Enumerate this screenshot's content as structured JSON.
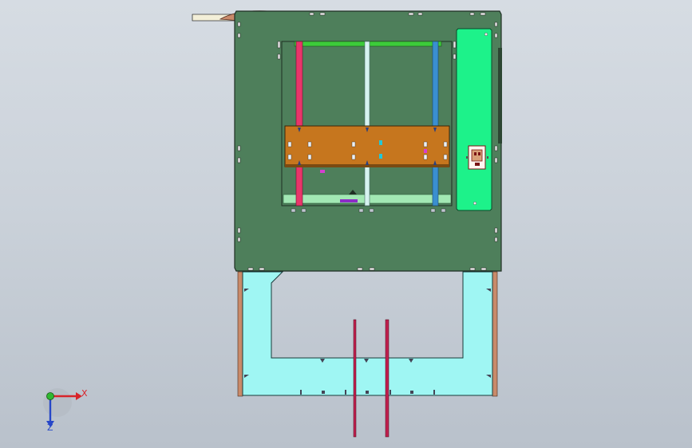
{
  "viewport": {
    "background_top": "#d6dce3",
    "background_bottom": "#b9c1cb"
  },
  "model": {
    "frame_color": "#4e7f5b",
    "side_panel_color": "#1df28a",
    "carriage_color": "#c6761e",
    "base_plate_color": "#9ff6f3",
    "rod_left_color": "#e8366a",
    "rod_center_color": "#d6f3f0",
    "rod_right_color": "#3a8fd0",
    "top_bar_color": "#3ccc3a",
    "leadscrew_color": "#c0204e",
    "bracket_color": "#c98a6a"
  },
  "triad": {
    "x_label": "X",
    "z_label": "Z",
    "x_color": "#d8242a",
    "y_color": "#2fb830",
    "z_color": "#2747c8"
  }
}
